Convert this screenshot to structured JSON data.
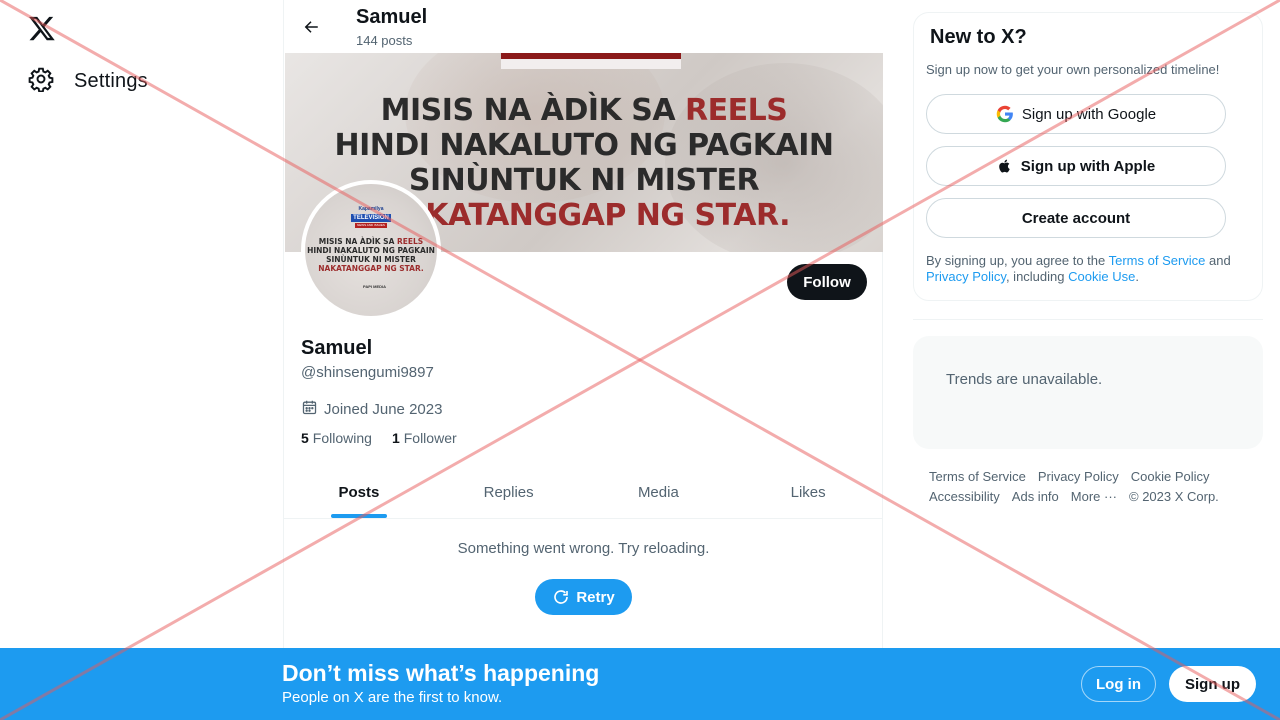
{
  "nav": {
    "settings_label": "Settings"
  },
  "header": {
    "name": "Samuel",
    "post_count": "144 posts"
  },
  "banner": {
    "line1_prefix": "MISIS NA ÀDÌK SA ",
    "line1_red": "REELS",
    "line2": "HINDI NAKALUTO NG PAGKAIN",
    "line3": "SINÙNTUK NI MISTER",
    "line4": "NAKATANGGAP NG STAR."
  },
  "avatar": {
    "brand_top": "Kapamilya",
    "brand_tv": "TELEVISION",
    "brand_strip": "NEWS AND ISSUES",
    "line1_prefix": "MISIS NA ÀDÌK SA ",
    "line1_red": "REELS",
    "line2": "HINDI NAKALUTO NG PAGKAIN",
    "line3": "SINÙNTUK NI MISTER",
    "line4": "NAKATANGGAP NG STAR.",
    "logo": "PAPI MEDIA"
  },
  "profile": {
    "follow_label": "Follow",
    "name": "Samuel",
    "handle": "@shinsengumi9897",
    "joined": "Joined June 2023",
    "following_count": "5",
    "following_label": "Following",
    "followers_count": "1",
    "followers_label": "Follower"
  },
  "tabs": [
    {
      "label": "Posts",
      "active": true
    },
    {
      "label": "Replies",
      "active": false
    },
    {
      "label": "Media",
      "active": false
    },
    {
      "label": "Likes",
      "active": false
    }
  ],
  "feed": {
    "error": "Something went wrong. Try reloading.",
    "retry_label": "Retry"
  },
  "signup_card": {
    "title": "New to X?",
    "subtitle": "Sign up now to get your own personalized timeline!",
    "google_label": "Sign up with Google",
    "apple_label": "Sign up with Apple",
    "create_label": "Create account",
    "terms_prefix": "By signing up, you agree to the ",
    "terms_link": "Terms of Service",
    "terms_and": " and ",
    "privacy_link": "Privacy Policy",
    "terms_including": ", including ",
    "cookie_link": "Cookie Use",
    "terms_end": "."
  },
  "trends": {
    "message": "Trends are unavailable."
  },
  "footer": {
    "terms": "Terms of Service",
    "privacy": "Privacy Policy",
    "cookie": "Cookie Policy",
    "accessibility": "Accessibility",
    "ads": "Ads info",
    "more": "More ···",
    "copyright": "© 2023 X Corp."
  },
  "bottom_bar": {
    "title": "Don’t miss what’s happening",
    "subtitle": "People on X are the first to know.",
    "login_label": "Log in",
    "signup_label": "Sign up"
  },
  "colors": {
    "accent": "#1d9bf0",
    "text": "#0f1419",
    "secondary": "#536471",
    "overlay_x": "#e85a5a"
  }
}
